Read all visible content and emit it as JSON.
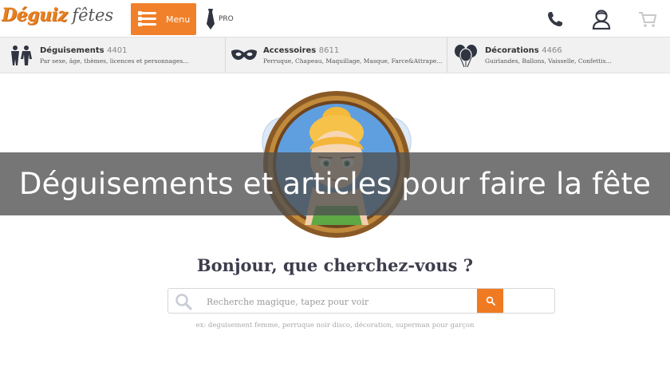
{
  "header": {
    "logo_main": "Déguiz",
    "logo_sub": "fêtes",
    "menu_label": "Menu",
    "pro_label": "PRO",
    "icons": [
      "phone-icon",
      "account-icon",
      "cart-icon"
    ]
  },
  "categories": [
    {
      "title": "Déguisements",
      "count": "4401",
      "subtitle": "Par sexe, âge, thèmes, licences et personnages...",
      "icon": "costume-icon"
    },
    {
      "title": "Accessoires",
      "count": "8611",
      "subtitle": "Perruque, Chapeau, Maquillage, Masque, Farce&Attrape...",
      "icon": "mask-icon"
    },
    {
      "title": "Décorations",
      "count": "4466",
      "subtitle": "Guirlandes, Ballons, Vaisselle, Confettis...",
      "icon": "balloons-icon"
    }
  ],
  "overlay_title": "Déguisements et articles pour faire la fête",
  "search": {
    "question": "Bonjour, que cherchez-vous ?",
    "placeholder": "Recherche magique, tapez pour voir",
    "hint": "ex: deguisement femme, perruque noir disco, décoration, superman pour garçon"
  },
  "colors": {
    "accent": "#f0802a",
    "overlay": "#505050",
    "category_bar": "#f1f1f1"
  }
}
